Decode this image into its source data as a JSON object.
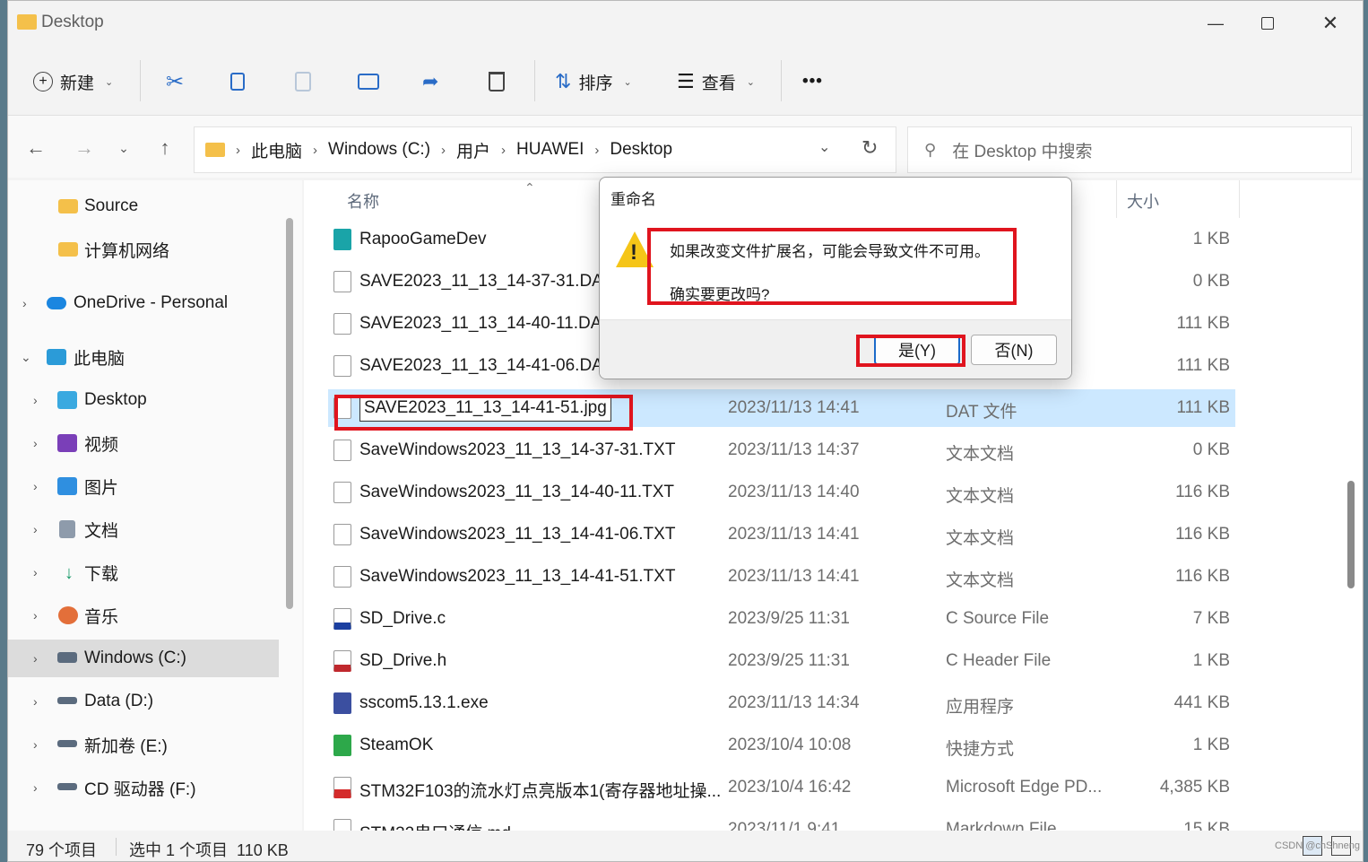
{
  "window": {
    "title": "Desktop"
  },
  "toolbar": {
    "new_label": "新建",
    "sort_label": "排序",
    "view_label": "查看",
    "more_label": "•••"
  },
  "address": {
    "crumbs": [
      "此电脑",
      "Windows (C:)",
      "用户",
      "HUAWEI",
      "Desktop"
    ],
    "search_placeholder": "在 Desktop 中搜索"
  },
  "sidebar": {
    "items": [
      {
        "label": "Source",
        "icon": "folder-icon"
      },
      {
        "label": "计算机网络",
        "icon": "folder-icon"
      },
      {
        "label": "OneDrive - Personal",
        "icon": "onedrive-icon"
      },
      {
        "label": "此电脑",
        "icon": "pc-icon"
      },
      {
        "label": "Desktop",
        "icon": "desktop-icon"
      },
      {
        "label": "视频",
        "icon": "video-icon"
      },
      {
        "label": "图片",
        "icon": "picture-icon"
      },
      {
        "label": "文档",
        "icon": "document-icon"
      },
      {
        "label": "下载",
        "icon": "download-icon"
      },
      {
        "label": "音乐",
        "icon": "music-icon"
      },
      {
        "label": "Windows (C:)",
        "icon": "drive-icon"
      },
      {
        "label": "Data (D:)",
        "icon": "drive-icon"
      },
      {
        "label": "新加卷 (E:)",
        "icon": "drive-icon"
      },
      {
        "label": "CD 驱动器 (F:)",
        "icon": "cd-drive-icon"
      }
    ]
  },
  "columns": {
    "name": "名称",
    "size": "大小"
  },
  "files": [
    {
      "name": "RapooGameDev",
      "date": "",
      "type": "",
      "size": "1 KB"
    },
    {
      "name": "SAVE2023_11_13_14-37-31.DA",
      "date": "",
      "type": "",
      "size": "0 KB"
    },
    {
      "name": "SAVE2023_11_13_14-40-11.DA",
      "date": "",
      "type": "",
      "size": "111 KB"
    },
    {
      "name": "SAVE2023_11_13_14-41-06.DA",
      "date": "",
      "type": "",
      "size": "111 KB"
    },
    {
      "name": "SAVE2023_11_13_14-41-51.jpg",
      "date": "2023/11/13 14:41",
      "type": "DAT 文件",
      "size": "111 KB"
    },
    {
      "name": "SaveWindows2023_11_13_14-37-31.TXT",
      "date": "2023/11/13 14:37",
      "type": "文本文档",
      "size": "0 KB"
    },
    {
      "name": "SaveWindows2023_11_13_14-40-11.TXT",
      "date": "2023/11/13 14:40",
      "type": "文本文档",
      "size": "116 KB"
    },
    {
      "name": "SaveWindows2023_11_13_14-41-06.TXT",
      "date": "2023/11/13 14:41",
      "type": "文本文档",
      "size": "116 KB"
    },
    {
      "name": "SaveWindows2023_11_13_14-41-51.TXT",
      "date": "2023/11/13 14:41",
      "type": "文本文档",
      "size": "116 KB"
    },
    {
      "name": "SD_Drive.c",
      "date": "2023/9/25 11:31",
      "type": "C Source File",
      "size": "7 KB"
    },
    {
      "name": "SD_Drive.h",
      "date": "2023/9/25 11:31",
      "type": "C Header File",
      "size": "1 KB"
    },
    {
      "name": "sscom5.13.1.exe",
      "date": "2023/11/13 14:34",
      "type": "应用程序",
      "size": "441 KB"
    },
    {
      "name": "SteamOK",
      "date": "2023/10/4 10:08",
      "type": "快捷方式",
      "size": "1 KB"
    },
    {
      "name": "STM32F103的流水灯点亮版本1(寄存器地址操...",
      "date": "2023/10/4 16:42",
      "type": "Microsoft Edge PD...",
      "size": "4,385 KB"
    },
    {
      "name": "STM32串口通信.md",
      "date": "2023/11/1 9:41",
      "type": "Markdown File",
      "size": "15 KB"
    }
  ],
  "status": {
    "count": "79 个项目",
    "selection": "选中 1 个项目  110 KB"
  },
  "dialog": {
    "title": "重命名",
    "message_line1": "如果改变文件扩展名，可能会导致文件不可用。",
    "message_line2": "确实要更改吗?",
    "yes_label": "是(Y)",
    "no_label": "否(N)"
  },
  "watermark": "CSDN @chShneng",
  "colors": {
    "selection": "#cce8ff",
    "highlight_box": "#e0141e"
  }
}
